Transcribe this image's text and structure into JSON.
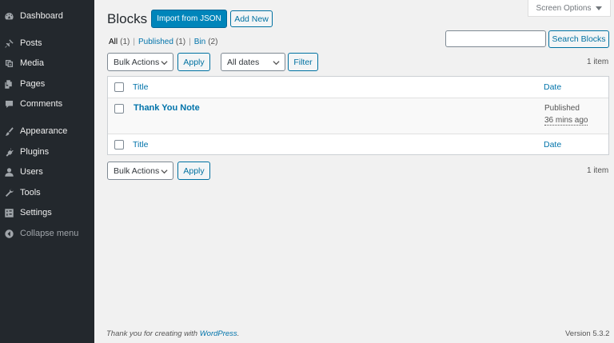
{
  "sidebar": {
    "items": [
      {
        "label": "Dashboard",
        "icon": "dashboard-icon"
      },
      {
        "label": "Posts",
        "icon": "pushpin-icon"
      },
      {
        "label": "Media",
        "icon": "media-icon"
      },
      {
        "label": "Pages",
        "icon": "page-icon"
      },
      {
        "label": "Comments",
        "icon": "comment-icon"
      },
      {
        "label": "Appearance",
        "icon": "paintbrush-icon"
      },
      {
        "label": "Plugins",
        "icon": "plug-icon"
      },
      {
        "label": "Users",
        "icon": "user-icon"
      },
      {
        "label": "Tools",
        "icon": "wrench-icon"
      },
      {
        "label": "Settings",
        "icon": "settings-icon"
      },
      {
        "label": "Collapse menu",
        "icon": "collapse-icon"
      }
    ]
  },
  "header": {
    "title": "Blocks",
    "import_label": "Import from JSON",
    "add_new_label": "Add New",
    "screen_options_label": "Screen Options"
  },
  "filters": {
    "all_label": "All",
    "all_count": "(1)",
    "published_label": "Published",
    "published_count": "(1)",
    "bin_label": "Bin",
    "bin_count": "(2)",
    "separator": "|"
  },
  "search": {
    "value": "",
    "button_label": "Search Blocks"
  },
  "tablenav": {
    "bulk_actions_label": "Bulk Actions",
    "apply_label": "Apply",
    "dates_label": "All dates",
    "filter_label": "Filter",
    "items_count": "1 item"
  },
  "table": {
    "columns": {
      "title": "Title",
      "date": "Date"
    },
    "rows": [
      {
        "title": "Thank You Note",
        "status": "Published",
        "time": "36 mins ago"
      }
    ]
  },
  "footer": {
    "thanks_prefix": "Thank you for creating with ",
    "wordpress_link": "WordPress",
    "thanks_suffix": ".",
    "version": "Version 5.3.2"
  },
  "colors": {
    "sidebar_bg": "#23282d",
    "primary": "#0085ba",
    "link": "#0073aa",
    "page_bg": "#f1f1f1"
  }
}
